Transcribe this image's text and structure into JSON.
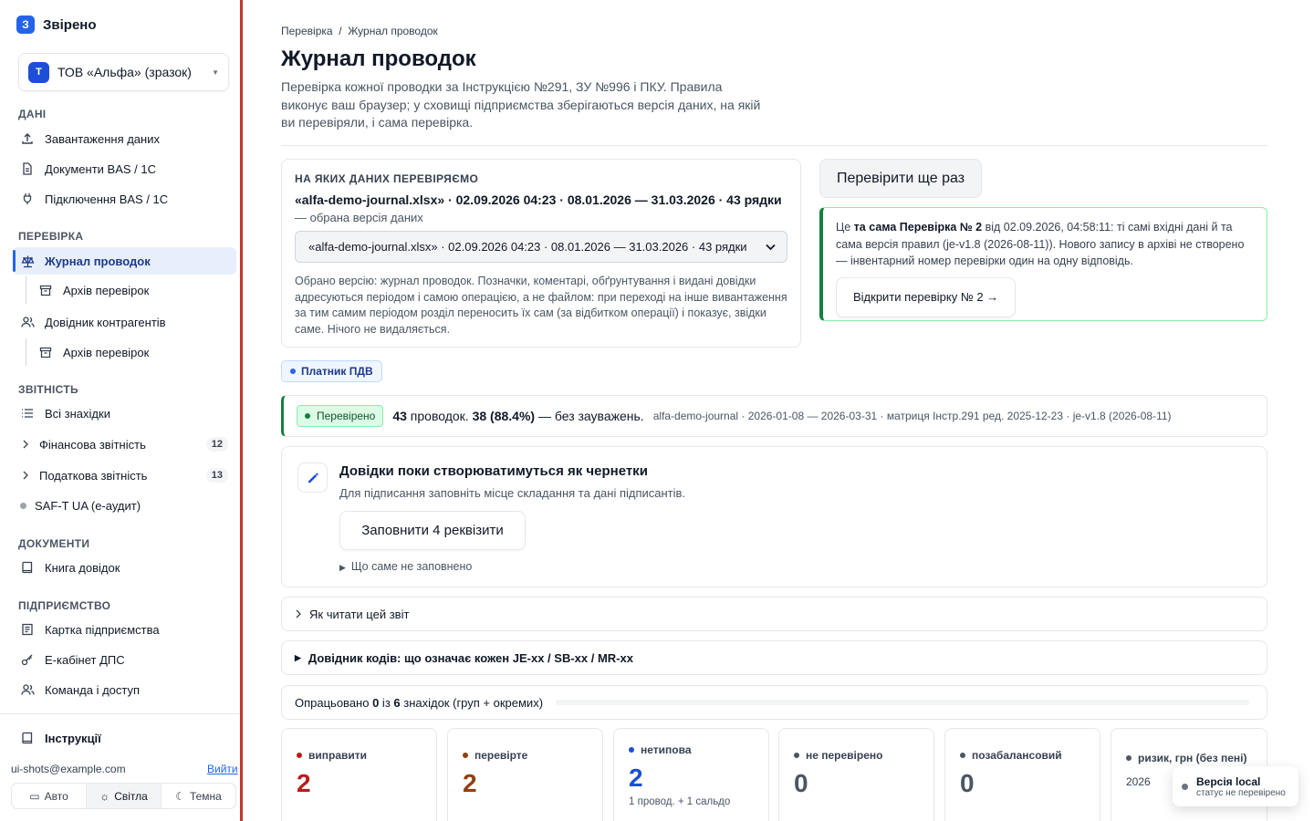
{
  "brand": {
    "logo": "З",
    "name": "Звірено"
  },
  "org": {
    "avatar": "Т",
    "name": "ТОВ «Альфа» (зразок)"
  },
  "sidebar": {
    "sections": [
      "ДАНІ",
      "ПЕРЕВІРКА",
      "ЗВІТНІСТЬ",
      "ДОКУМЕНТИ",
      "ПІДПРИЄМСТВО"
    ],
    "items": [
      {
        "label": "Завантаження даних",
        "icon": "upload-icon"
      },
      {
        "label": "Документи BAS / 1С",
        "icon": "document-icon"
      },
      {
        "label": "Підключення BAS / 1С",
        "icon": "plug-icon"
      },
      {
        "label": "Журнал проводок",
        "icon": "scales-icon",
        "active": true
      },
      {
        "label": "Архів перевірок",
        "icon": "archive-icon"
      },
      {
        "label": "Довідник контрагентів",
        "icon": "users-icon"
      },
      {
        "label": "Архів перевірок",
        "icon": "archive-icon"
      },
      {
        "label": "Всі знахідки",
        "icon": "list-icon"
      },
      {
        "label": "Фінансова звітність",
        "icon": "chevron-right-icon",
        "badge": "12"
      },
      {
        "label": "Податкова звітність",
        "icon": "chevron-right-icon",
        "badge": "13"
      },
      {
        "label": "SAF-T UA (е-аудит)",
        "icon": "dot-icon"
      },
      {
        "label": "Книга довідок",
        "icon": "book-icon"
      },
      {
        "label": "Картка підприємства",
        "icon": "id-card-icon"
      },
      {
        "label": "Е-кабінет ДПС",
        "icon": "key-icon"
      },
      {
        "label": "Команда і доступ",
        "icon": "users-icon"
      },
      {
        "label": "Інструкції",
        "icon": "book-icon"
      }
    ],
    "email": "ui-shots@example.com",
    "logout": "Вийти",
    "theme": {
      "auto": "Авто",
      "light": "Світла",
      "dark": "Темна"
    }
  },
  "main": {
    "breadcrumb": "Перевірка  /  Журнал проводок",
    "title": "Журнал проводок",
    "description": "Перевірка кожної проводки за Інструкцією №291, ЗУ №996 і ПКУ. Правила виконує ваш браузер; у сховищі підприємства зберігаються версія даних, на якій ви перевіряли, і сама перевірка.",
    "source": {
      "label": "НА ЯКИХ ДАНИХ ПЕРЕВІРЯЄМО",
      "headline": "«alfa-demo-journal.xlsx» · 02.09.2026 04:23 · 08.01.2026 — 31.03.2026 · 43 рядки",
      "sub": "— обрана версія даних",
      "select": "«alfa-demo-journal.xlsx» · 02.09.2026 04:23 · 08.01.2026 — 31.03.2026 · 43 рядки",
      "note": "Обрано версію: журнал проводок. Позначки, коментарі, обґрунтування і видані довідки адресуються періодом і самою операцією, а не файлом: при переході на інше вивантаження за тим самим періодом розділ переносить їх сам (за відбитком операції) і показує, звідки саме. Нічого не видаляється."
    },
    "rerun": "Перевірити ще раз",
    "same": {
      "p1": "Це ",
      "strong": "та сама Перевірка № 2",
      "p2": " від 02.09.2026, 04:58:11: ті самі вхідні дані й та сама версія правил (je-v1.8 (2026-08-11)). Нового запису в архіві не створено — інвентарний номер перевірки один на одну відповідь.",
      "button": "Відкрити перевірку № 2 →"
    },
    "pdv": "Платник ПДВ",
    "status": {
      "badge": "Перевірено",
      "count": "43",
      "t1": " проводок. ",
      "ok": "38 (88.4%)",
      "t2": " — без зауважень.",
      "meta": "alfa-demo-journal · 2026-01-08 — 2026-03-31 · матриця Інстр.291 ред. 2025-12-23 · je-v1.8 (2026-08-11)"
    },
    "draft": {
      "title": "Довідки поки створюватимуться як чернетки",
      "sub": "Для підписання заповніть місце складання та дані підписантів.",
      "button": "Заповнити 4 реквізити",
      "more": "Що саме не заповнено"
    },
    "howto": "Як читати цей звіт",
    "codes": "Довідник кодів: що означає кожен JE-xx / SB-xx / MR-xx",
    "progress": {
      "t1": "Опрацьовано ",
      "done": "0",
      "t2": " із ",
      "total": "6",
      "t3": " знахідок (груп + окремих)",
      "fraction": 0
    },
    "kpis": [
      {
        "label": "виправити",
        "value": "2",
        "color": "#b91c1c"
      },
      {
        "label": "перевірте",
        "value": "2",
        "color": "#92400e"
      },
      {
        "label": "нетипова",
        "value": "2",
        "color": "#1d4ed8",
        "note": "1 провод. + 1 сальдо"
      },
      {
        "label": "не перевірено",
        "value": "0",
        "color": "#4b5563"
      },
      {
        "label": "позабалансовий",
        "value": "0",
        "color": "#4b5563"
      },
      {
        "label": "ризик, грн (без пені)",
        "value": "2026",
        "color": "#4b5563"
      }
    ]
  },
  "toast": {
    "title": "Версія local",
    "sub": "статус не перевірено"
  }
}
